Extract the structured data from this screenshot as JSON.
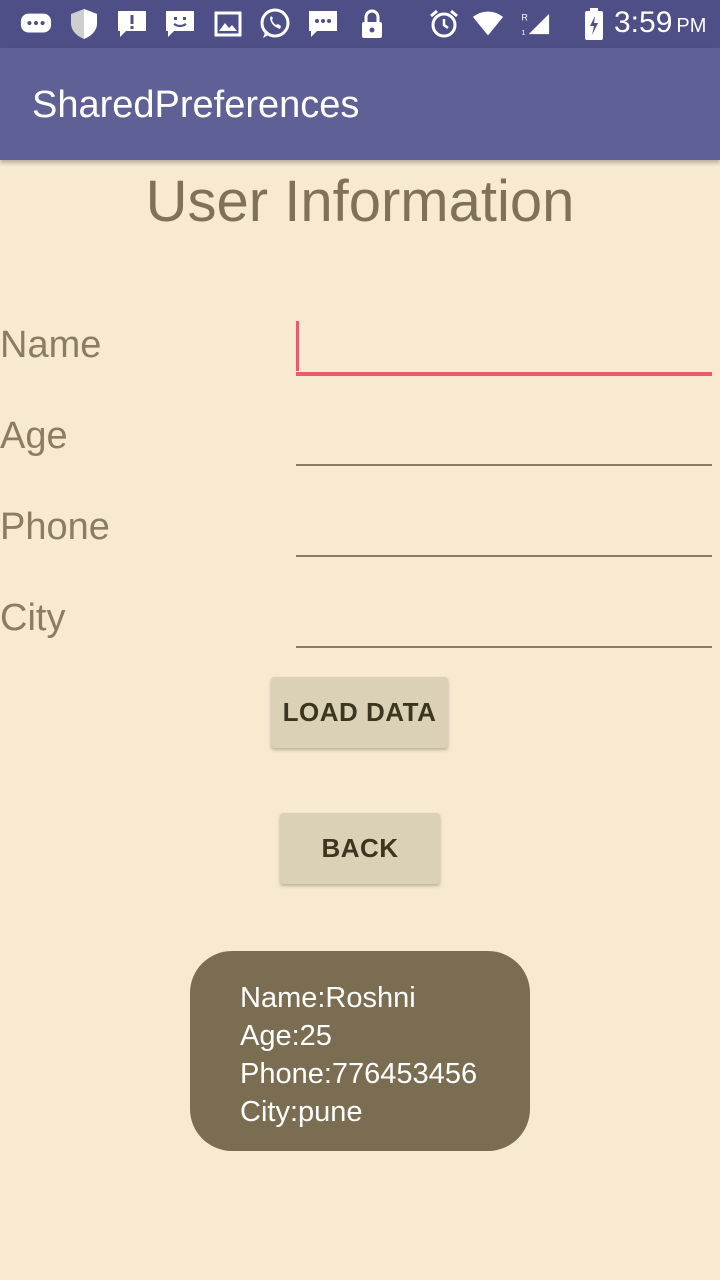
{
  "status_bar": {
    "time": "3:59",
    "ampm": "PM",
    "icons": [
      "chat-bubble-icon",
      "shield-icon",
      "alert-icon",
      "face-icon",
      "image-icon",
      "whatsapp-icon",
      "message-icon",
      "lock-icon",
      "alarm-icon",
      "wifi-icon",
      "signal-icon",
      "battery-icon"
    ],
    "signal_label": "R",
    "sim_label": "1"
  },
  "app_bar": {
    "title": "SharedPreferences"
  },
  "form": {
    "heading": "User Information",
    "fields": [
      {
        "label": "Name",
        "value": ""
      },
      {
        "label": "Age",
        "value": ""
      },
      {
        "label": "Phone",
        "value": ""
      },
      {
        "label": "City",
        "value": ""
      }
    ]
  },
  "buttons": {
    "load": "LOAD DATA",
    "back": "BACK"
  },
  "toast": {
    "name": "Name:Roshni",
    "age": "Age:25",
    "phone": "Phone:776453456",
    "city": "City:pune"
  },
  "colors": {
    "status_bar": "#4d4f86",
    "app_bar": "#5f6196",
    "background": "#f7ead1",
    "accent": "#e95a6e",
    "toast": "#7b6d51"
  }
}
